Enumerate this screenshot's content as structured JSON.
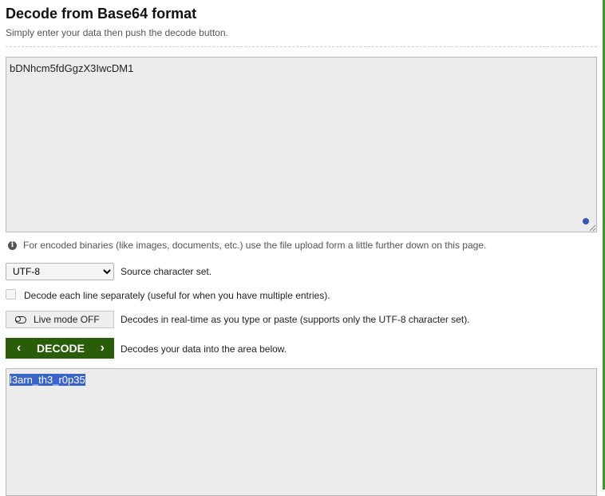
{
  "page": {
    "title": "Decode from Base64 format",
    "subtitle": "Simply enter your data then push the decode button."
  },
  "input": {
    "value": "bDNhcm5fdGgzX3IwcDM1"
  },
  "info": {
    "icon": "info-icon",
    "text": "For encoded binaries (like images, documents, etc.) use the file upload form a little further down on this page."
  },
  "charset": {
    "selected": "UTF-8",
    "description": "Source character set."
  },
  "separate_lines": {
    "checked": false,
    "label": "Decode each line separately (useful for when you have multiple entries)."
  },
  "live_mode": {
    "label": "Live mode OFF",
    "description": "Decodes in real-time as you type or paste (supports only the UTF-8 character set)."
  },
  "decode": {
    "label": "DECODE",
    "description": "Decodes your data into the area below."
  },
  "output": {
    "value": "l3arn_th3_r0p35"
  },
  "colors": {
    "accent_green": "#2a5d0a",
    "right_bar": "#3d9a2b",
    "selection": "#3a64c8"
  }
}
